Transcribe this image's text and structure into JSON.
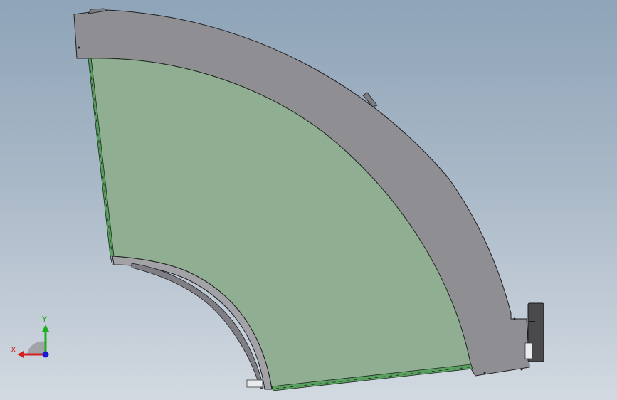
{
  "viewport": {
    "background_top": "#8ea4b8",
    "background_bottom": "#d2d9e1"
  },
  "model": {
    "frame_color": "#8f8e93",
    "panel_color": "#8fae92",
    "edge_color": "#1f2a1f",
    "trim_color": "#2f7a3a",
    "hardware_color": "#3c3c3c",
    "sensor_color": "#e9ecef"
  },
  "triad": {
    "x_label": "X",
    "y_label": "Y",
    "x_color": "#d42020",
    "y_color": "#1fae1f",
    "z_color": "#1a1ad6"
  }
}
